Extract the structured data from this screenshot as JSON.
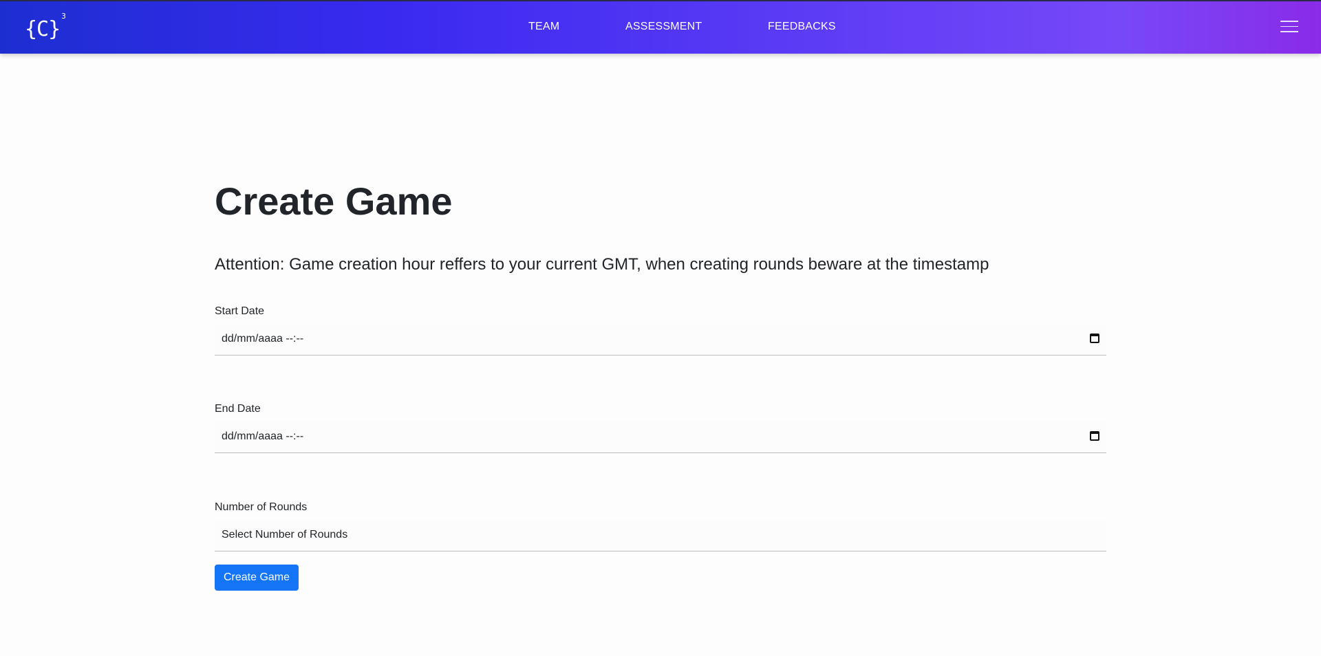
{
  "navbar": {
    "logo_text": "{C}",
    "logo_sup": "3",
    "links": [
      "TEAM",
      "ASSESSMENT",
      "FEEDBACKS"
    ],
    "menu_icon": "hamburger-menu-icon"
  },
  "main": {
    "title": "Create Game",
    "attention": "Attention: Game creation hour reffers to your current GMT, when creating rounds beware at the timestamp",
    "start_date": {
      "label": "Start Date",
      "value": "dd/mm/aaaa --:--",
      "icon": "calendar-icon"
    },
    "end_date": {
      "label": "End Date",
      "value": "dd/mm/aaaa --:--",
      "icon": "calendar-icon"
    },
    "rounds": {
      "label": "Number of Rounds",
      "value": "Select Number of Rounds"
    },
    "submit_label": "Create Game"
  },
  "colors": {
    "nav_gradient_start": "#1d2ed1",
    "nav_gradient_end": "#8a2be8",
    "button": "#1476f6"
  }
}
